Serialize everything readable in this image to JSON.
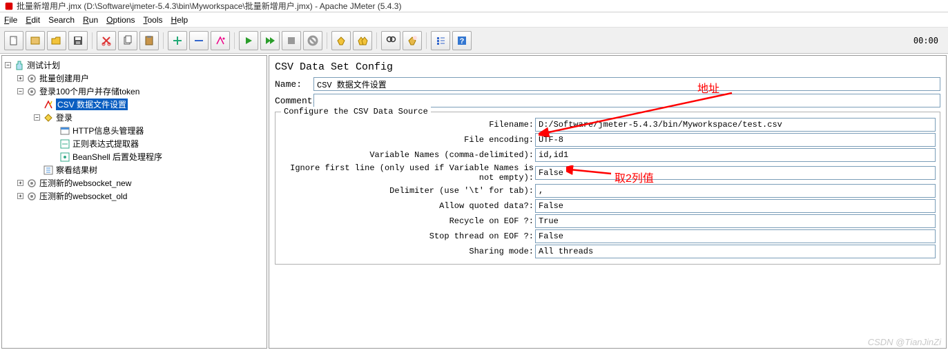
{
  "window": {
    "title": "批量新增用户.jmx (D:\\Software\\jmeter-5.4.3\\bin\\Myworkspace\\批量新增用户.jmx) - Apache JMeter (5.4.3)"
  },
  "menu": {
    "file": "File",
    "edit": "Edit",
    "search": "Search",
    "run": "Run",
    "options": "Options",
    "tools": "Tools",
    "help": "Help"
  },
  "toolbar": {
    "time": "00:00"
  },
  "tree": {
    "root": "测试计划",
    "n1": "批量创建用户",
    "n2": "登录100个用户并存储token",
    "n2a": "CSV 数据文件设置",
    "n2b": "登录",
    "n2b1": "HTTP信息头管理器",
    "n2b2": "正则表达式提取器",
    "n2b3": "BeanShell 后置处理程序",
    "n2c": "察看结果树",
    "n3": "压测新的websocket_new",
    "n4": "压测新的websocket_old"
  },
  "panel": {
    "title": "CSV Data Set Config",
    "name_label": "Name:",
    "name_value": "CSV 数据文件设置",
    "comments_label": "Comments:",
    "comments_value": "",
    "fieldset_legend": "Configure the CSV Data Source",
    "rows": {
      "filename_label": "Filename:",
      "filename_value": "D:/Software/jmeter-5.4.3/bin/Myworkspace/test.csv",
      "encoding_label": "File encoding:",
      "encoding_value": "UTF-8",
      "varnames_label": "Variable Names (comma-delimited):",
      "varnames_value": "id,id1",
      "ignore_label": "Ignore first line (only used if Variable Names is not empty):",
      "ignore_value": "False",
      "delimiter_label": "Delimiter (use '\\t' for tab):",
      "delimiter_value": ",",
      "quoted_label": "Allow quoted data?:",
      "quoted_value": "False",
      "recycle_label": "Recycle on EOF ?:",
      "recycle_value": "True",
      "stop_label": "Stop thread on EOF ?:",
      "stop_value": "False",
      "sharing_label": "Sharing mode:",
      "sharing_value": "All threads"
    }
  },
  "annotations": {
    "addr": "地址",
    "cols": "取2列值"
  },
  "watermark": "CSDN @TianJinZi"
}
